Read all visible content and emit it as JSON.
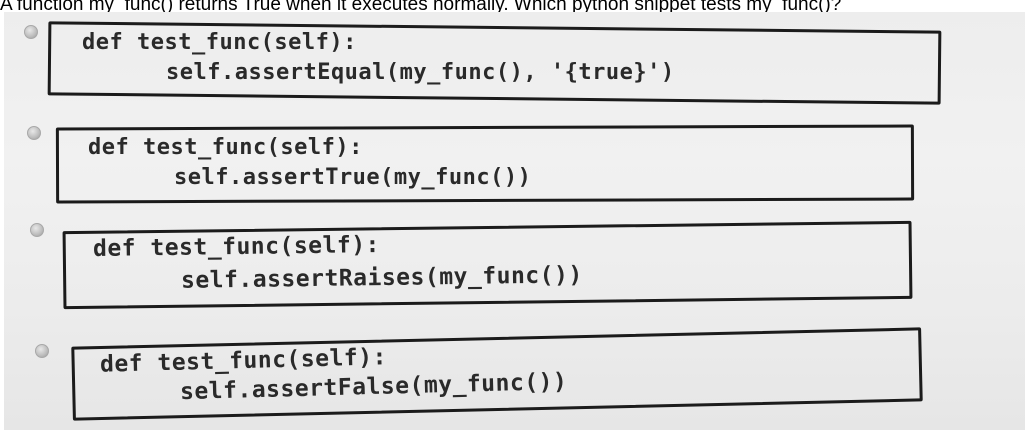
{
  "question": {
    "text": "A function my_func() returns True when it executes normally. Which python snippet tests my_func()?"
  },
  "options": [
    {
      "line1": "def test_func(self):",
      "line2": "self.assertEqual(my_func(), '{true}')"
    },
    {
      "line1": "def test_func(self):",
      "line2": "self.assertTrue(my_func())"
    },
    {
      "line1": "def test_func(self):",
      "line2": "self.assertRaises(my_func())"
    },
    {
      "line1": "def test_func(self):",
      "line2": "self.assertFalse(my_func())"
    }
  ]
}
